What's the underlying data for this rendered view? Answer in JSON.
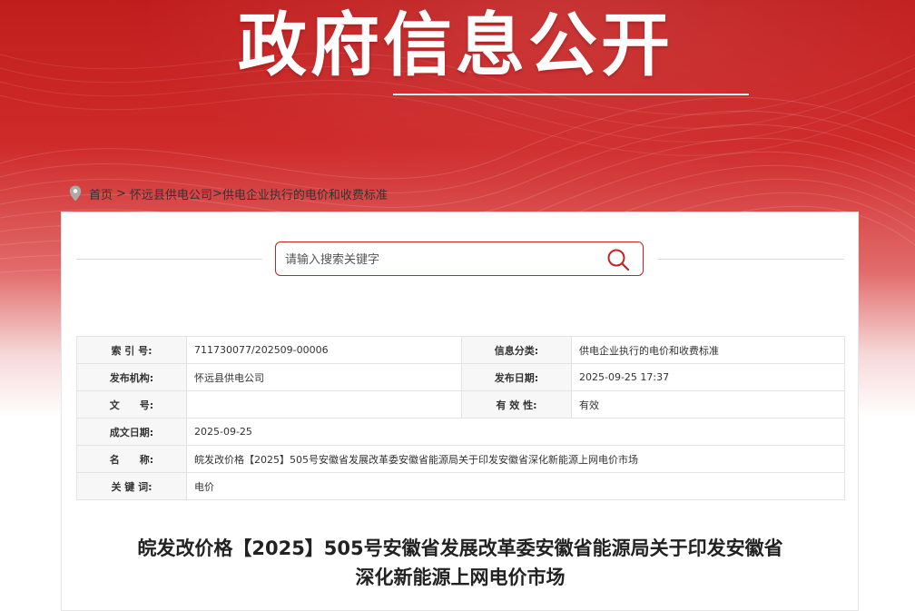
{
  "header": {
    "title": "政府信息公开"
  },
  "breadcrumb": {
    "icon": "location-pin-icon",
    "home": "首页",
    "sep1": ">",
    "company": "怀远县供电公司",
    "sep2": ">",
    "current": "供电企业执行的电价和收费标准"
  },
  "search": {
    "placeholder": "请输入搜索关键字",
    "icon": "search-icon",
    "accent": "#c12424"
  },
  "meta": {
    "index_label": "索 引 号:",
    "index_value": "711730077/202509-00006",
    "category_label": "信息分类:",
    "category_value": "供电企业执行的电价和收费标准",
    "publisher_label": "发布机构:",
    "publisher_value": "怀远县供电公司",
    "publish_date_label": "发布日期:",
    "publish_date_value": "2025-09-25 17:37",
    "doc_no_label": "文　　号:",
    "doc_no_value": "",
    "validity_label": "有 效 性:",
    "validity_value": "有效",
    "created_label": "成文日期:",
    "created_value": "2025-09-25",
    "name_label": "名　　称:",
    "name_value": "皖发改价格【2025】505号安徽省发展改革委安徽省能源局关于印发安徽省深化新能源上网电价市场",
    "keywords_label": "关 键 词:",
    "keywords_value": "电价"
  },
  "document": {
    "title_line1": "皖发改价格【2025】505号安徽省发展改革委安徽省能源局关于印发安徽省",
    "title_line2": "深化新能源上网电价市场"
  },
  "colors": {
    "banner_red": "#c01d1d",
    "accent": "#c12424"
  }
}
